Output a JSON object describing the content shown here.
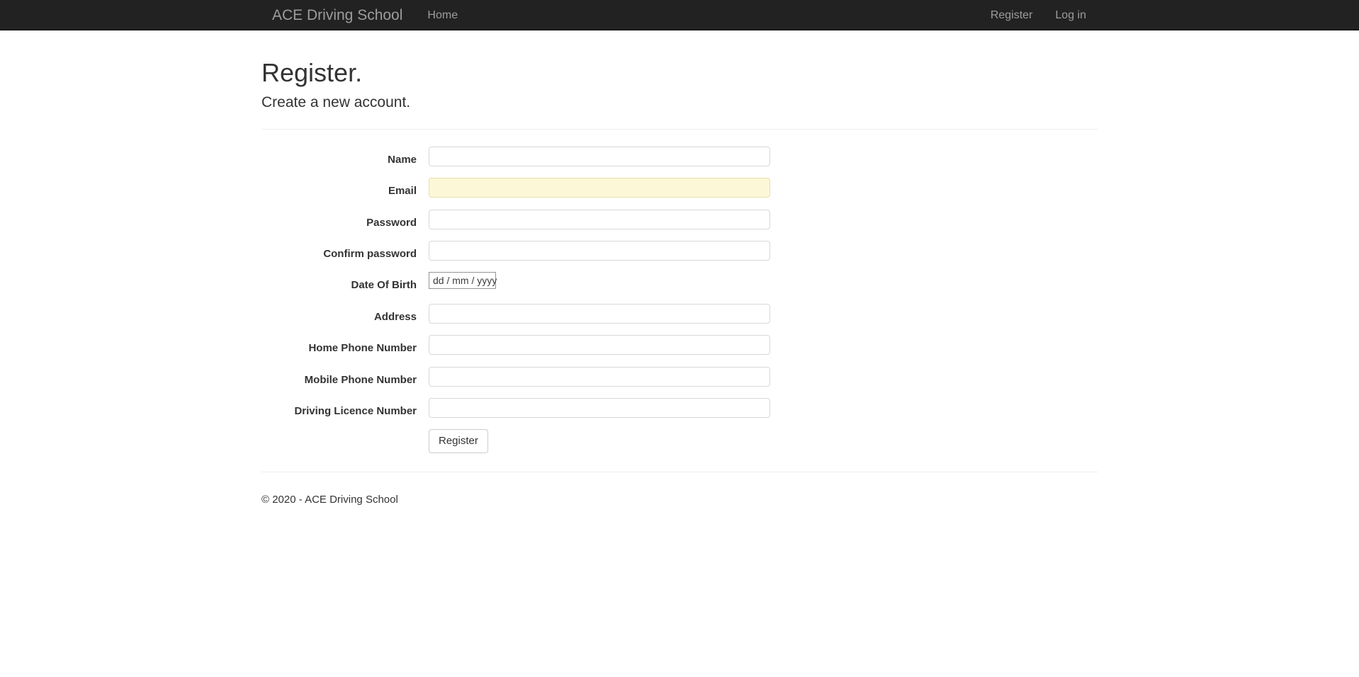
{
  "navbar": {
    "brand": "ACE Driving School",
    "left_links": [
      {
        "label": "Home"
      }
    ],
    "right_links": [
      {
        "label": "Register"
      },
      {
        "label": "Log in"
      }
    ],
    "background_color": "#222222",
    "link_color": "#9d9d9d"
  },
  "page": {
    "title": "Register.",
    "subtitle": "Create a new account."
  },
  "form": {
    "fields": [
      {
        "label": "Name",
        "value": "",
        "placeholder": "",
        "type": "text"
      },
      {
        "label": "Email",
        "value": "",
        "placeholder": "",
        "type": "email"
      },
      {
        "label": "Password",
        "value": "",
        "placeholder": "",
        "type": "password"
      },
      {
        "label": "Confirm password",
        "value": "",
        "placeholder": "",
        "type": "password"
      },
      {
        "label": "Date Of Birth",
        "value": "",
        "placeholder": "dd / mm / yyyy",
        "type": "date"
      },
      {
        "label": "Address",
        "value": "",
        "placeholder": "",
        "type": "text"
      },
      {
        "label": "Home Phone Number",
        "value": "",
        "placeholder": "",
        "type": "text"
      },
      {
        "label": "Mobile Phone Number",
        "value": "",
        "placeholder": "",
        "type": "text"
      },
      {
        "label": "Driving Licence Number",
        "value": "",
        "placeholder": "",
        "type": "text"
      }
    ],
    "submit_label": "Register",
    "autofill_highlight_color": "#fcf8d7"
  },
  "footer": {
    "copyright": "© 2020 - ACE Driving School"
  }
}
